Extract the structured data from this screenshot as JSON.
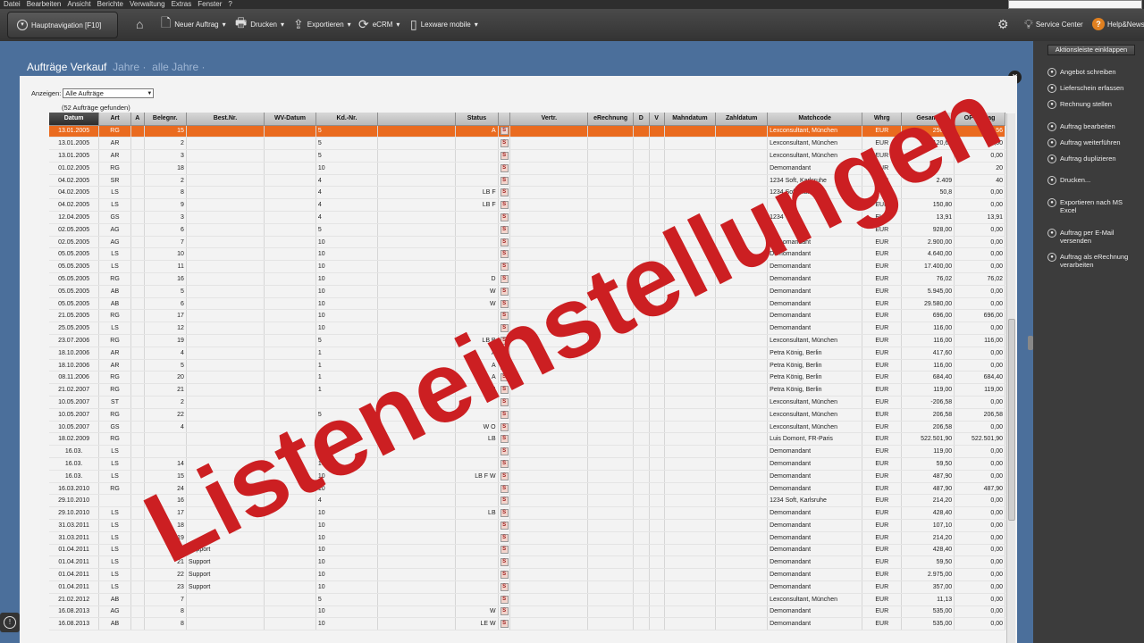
{
  "menu": [
    "Datei",
    "Bearbeiten",
    "Ansicht",
    "Berichte",
    "Verwaltung",
    "Extras",
    "Fenster",
    "?"
  ],
  "toolbar": {
    "hauptnavigation": "Hauptnavigation [F10]",
    "neuer_auftrag": "Neuer Auftrag",
    "drucken": "Drucken",
    "exportieren": "Exportieren",
    "ecrm": "eCRM",
    "lexware_mobile": "Lexware mobile",
    "service_center": "Service Center",
    "help_news": "Help&News"
  },
  "page": {
    "title": "Aufträge Verkauf",
    "crumb_jahre": "Jahre",
    "crumb_alle": "alle Jahre",
    "filter_label": "Anzeigen:",
    "filter_value": "Alle Aufträge",
    "found": "(52 Aufträge gefunden)"
  },
  "columns": [
    "Datum",
    "Art",
    "A",
    "Belegnr.",
    "Best.Nr.",
    "WV-Datum",
    "Kd.-Nr.",
    "",
    "Status",
    "",
    "Vertr.",
    "eRechnung",
    "D",
    "V",
    "Mahndatum",
    "Zahldatum",
    "Matchcode",
    "Whrg",
    "Gesamt",
    "OP-Betrag"
  ],
  "rows": [
    {
      "datum": "13.01.2005",
      "art": "RG",
      "belegnr": "15",
      "best": "",
      "kd": "5",
      "status": "A",
      "match": "Lexconsultant, München",
      "whrg": "EUR",
      "gesamt": "250,56",
      "op": "250,56"
    },
    {
      "datum": "13.01.2005",
      "art": "AR",
      "belegnr": "2",
      "best": "",
      "kd": "5",
      "status": "",
      "match": "Lexconsultant, München",
      "whrg": "EUR",
      "gesamt": "120,64",
      "op": "0,00"
    },
    {
      "datum": "13.01.2005",
      "art": "AR",
      "belegnr": "3",
      "best": "",
      "kd": "5",
      "status": "",
      "match": "Lexconsultant, München",
      "whrg": "EUR",
      "gesamt": "",
      "op": "0,00"
    },
    {
      "datum": "01.02.2005",
      "art": "RG",
      "belegnr": "18",
      "best": "",
      "kd": "10",
      "status": "",
      "match": "Demomandant",
      "whrg": "EUR",
      "gesamt": "",
      "op": "20"
    },
    {
      "datum": "04.02.2005",
      "art": "SR",
      "belegnr": "2",
      "best": "",
      "kd": "4",
      "status": "",
      "match": "1234 Soft, Karlsruhe",
      "whrg": "EUR",
      "gesamt": "2.409",
      "op": "40"
    },
    {
      "datum": "04.02.2005",
      "art": "LS",
      "belegnr": "8",
      "best": "",
      "kd": "4",
      "status": "LB F",
      "match": "1234 Soft, Karlsruhe",
      "whrg": "EUR",
      "gesamt": "50,8",
      "op": "0,00"
    },
    {
      "datum": "04.02.2005",
      "art": "LS",
      "belegnr": "9",
      "best": "",
      "kd": "4",
      "status": "LB F",
      "match": "",
      "whrg": "EUR",
      "gesamt": "150,80",
      "op": "0,00"
    },
    {
      "datum": "12.04.2005",
      "art": "GS",
      "belegnr": "3",
      "best": "",
      "kd": "4",
      "status": "",
      "match": "1234",
      "whrg": "EUR",
      "gesamt": "13,91",
      "op": "13,91"
    },
    {
      "datum": "02.05.2005",
      "art": "AG",
      "belegnr": "6",
      "best": "",
      "kd": "5",
      "status": "",
      "match": "",
      "whrg": "EUR",
      "gesamt": "928,00",
      "op": "0,00"
    },
    {
      "datum": "02.05.2005",
      "art": "AG",
      "belegnr": "7",
      "best": "",
      "kd": "10",
      "status": "",
      "match": "Demomandant",
      "whrg": "EUR",
      "gesamt": "2.900,00",
      "op": "0,00"
    },
    {
      "datum": "05.05.2005",
      "art": "LS",
      "belegnr": "10",
      "best": "",
      "kd": "10",
      "status": "",
      "match": "Demomandant",
      "whrg": "EUR",
      "gesamt": "4.640,00",
      "op": "0,00"
    },
    {
      "datum": "05.05.2005",
      "art": "LS",
      "belegnr": "11",
      "best": "",
      "kd": "10",
      "status": "",
      "match": "Demomandant",
      "whrg": "EUR",
      "gesamt": "17.400,00",
      "op": "0,00"
    },
    {
      "datum": "05.05.2005",
      "art": "RG",
      "belegnr": "16",
      "best": "",
      "kd": "10",
      "status": "D",
      "match": "Demomandant",
      "whrg": "EUR",
      "gesamt": "76,02",
      "op": "76,02"
    },
    {
      "datum": "05.05.2005",
      "art": "AB",
      "belegnr": "5",
      "best": "",
      "kd": "10",
      "status": "W",
      "match": "Demomandant",
      "whrg": "EUR",
      "gesamt": "5.945,00",
      "op": "0,00"
    },
    {
      "datum": "05.05.2005",
      "art": "AB",
      "belegnr": "6",
      "best": "",
      "kd": "10",
      "status": "W",
      "match": "Demomandant",
      "whrg": "EUR",
      "gesamt": "29.580,00",
      "op": "0,00"
    },
    {
      "datum": "21.05.2005",
      "art": "RG",
      "belegnr": "17",
      "best": "",
      "kd": "10",
      "status": "",
      "match": "Demomandant",
      "whrg": "EUR",
      "gesamt": "696,00",
      "op": "696,00"
    },
    {
      "datum": "25.05.2005",
      "art": "LS",
      "belegnr": "12",
      "best": "",
      "kd": "10",
      "status": "",
      "match": "Demomandant",
      "whrg": "EUR",
      "gesamt": "116,00",
      "op": "0,00"
    },
    {
      "datum": "23.07.2006",
      "art": "RG",
      "belegnr": "19",
      "best": "",
      "kd": "5",
      "status": "LB B",
      "match": "Lexconsultant, München",
      "whrg": "EUR",
      "gesamt": "116,00",
      "op": "116,00"
    },
    {
      "datum": "18.10.2006",
      "art": "AR",
      "belegnr": "4",
      "best": "",
      "kd": "1",
      "status": "A",
      "match": "Petra König, Berlin",
      "whrg": "EUR",
      "gesamt": "417,60",
      "op": "0,00"
    },
    {
      "datum": "18.10.2006",
      "art": "AR",
      "belegnr": "5",
      "best": "",
      "kd": "1",
      "status": "A",
      "match": "Petra König, Berlin",
      "whrg": "EUR",
      "gesamt": "116,00",
      "op": "0,00"
    },
    {
      "datum": "08.11.2006",
      "art": "RG",
      "belegnr": "20",
      "best": "",
      "kd": "1",
      "status": "A",
      "match": "Petra König, Berlin",
      "whrg": "EUR",
      "gesamt": "684,40",
      "op": "684,40"
    },
    {
      "datum": "21.02.2007",
      "art": "RG",
      "belegnr": "21",
      "best": "",
      "kd": "1",
      "status": "B",
      "match": "Petra König, Berlin",
      "whrg": "EUR",
      "gesamt": "119,00",
      "op": "119,00"
    },
    {
      "datum": "10.05.2007",
      "art": "ST",
      "belegnr": "2",
      "best": "",
      "kd": "",
      "status": "",
      "match": "Lexconsultant, München",
      "whrg": "EUR",
      "gesamt": "-206,58",
      "op": "0,00"
    },
    {
      "datum": "10.05.2007",
      "art": "RG",
      "belegnr": "22",
      "best": "",
      "kd": "5",
      "status": "",
      "match": "Lexconsultant, München",
      "whrg": "EUR",
      "gesamt": "206,58",
      "op": "206,58"
    },
    {
      "datum": "10.05.2007",
      "art": "GS",
      "belegnr": "4",
      "best": "",
      "kd": "",
      "status": "W O",
      "match": "Lexconsultant, München",
      "whrg": "EUR",
      "gesamt": "206,58",
      "op": "0,00"
    },
    {
      "datum": "18.02.2009",
      "art": "RG",
      "belegnr": "",
      "best": "",
      "kd": "3",
      "status": "LB",
      "match": "Luis Domont, FR-Paris",
      "whrg": "EUR",
      "gesamt": "522.501,90",
      "op": "522.501,90"
    },
    {
      "datum": "16.03.",
      "art": "LS",
      "belegnr": "",
      "best": "",
      "kd": "10",
      "status": "",
      "match": "Demomandant",
      "whrg": "EUR",
      "gesamt": "119,00",
      "op": "0,00"
    },
    {
      "datum": "16.03.",
      "art": "LS",
      "belegnr": "14",
      "best": "",
      "kd": "10",
      "status": "",
      "match": "Demomandant",
      "whrg": "EUR",
      "gesamt": "59,50",
      "op": "0,00"
    },
    {
      "datum": "16.03.",
      "art": "LS",
      "belegnr": "15",
      "best": "",
      "kd": "10",
      "status": "LB F W",
      "match": "Demomandant",
      "whrg": "EUR",
      "gesamt": "487,90",
      "op": "0,00"
    },
    {
      "datum": "16.03.2010",
      "art": "RG",
      "belegnr": "24",
      "best": "",
      "kd": "10",
      "status": "",
      "match": "Demomandant",
      "whrg": "EUR",
      "gesamt": "487,90",
      "op": "487,90"
    },
    {
      "datum": "29.10.2010",
      "art": "",
      "belegnr": "16",
      "best": "",
      "kd": "4",
      "status": "",
      "match": "1234 Soft, Karlsruhe",
      "whrg": "EUR",
      "gesamt": "214,20",
      "op": "0,00"
    },
    {
      "datum": "29.10.2010",
      "art": "LS",
      "belegnr": "17",
      "best": "",
      "kd": "10",
      "status": "LB",
      "match": "Demomandant",
      "whrg": "EUR",
      "gesamt": "428,40",
      "op": "0,00"
    },
    {
      "datum": "31.03.2011",
      "art": "LS",
      "belegnr": "18",
      "best": "",
      "kd": "10",
      "status": "",
      "match": "Demomandant",
      "whrg": "EUR",
      "gesamt": "107,10",
      "op": "0,00"
    },
    {
      "datum": "31.03.2011",
      "art": "LS",
      "belegnr": "19",
      "best": "",
      "kd": "10",
      "status": "",
      "match": "Demomandant",
      "whrg": "EUR",
      "gesamt": "214,20",
      "op": "0,00"
    },
    {
      "datum": "01.04.2011",
      "art": "LS",
      "belegnr": "20",
      "best": "Support",
      "kd": "10",
      "status": "",
      "match": "Demomandant",
      "whrg": "EUR",
      "gesamt": "428,40",
      "op": "0,00"
    },
    {
      "datum": "01.04.2011",
      "art": "LS",
      "belegnr": "21",
      "best": "Support",
      "kd": "10",
      "status": "",
      "match": "Demomandant",
      "whrg": "EUR",
      "gesamt": "59,50",
      "op": "0,00"
    },
    {
      "datum": "01.04.2011",
      "art": "LS",
      "belegnr": "22",
      "best": "Support",
      "kd": "10",
      "status": "",
      "match": "Demomandant",
      "whrg": "EUR",
      "gesamt": "2.975,00",
      "op": "0,00"
    },
    {
      "datum": "01.04.2011",
      "art": "LS",
      "belegnr": "23",
      "best": "Support",
      "kd": "10",
      "status": "",
      "match": "Demomandant",
      "whrg": "EUR",
      "gesamt": "357,00",
      "op": "0,00"
    },
    {
      "datum": "21.02.2012",
      "art": "AB",
      "belegnr": "7",
      "best": "",
      "kd": "5",
      "status": "",
      "match": "Lexconsultant, München",
      "whrg": "EUR",
      "gesamt": "11,13",
      "op": "0,00"
    },
    {
      "datum": "16.08.2013",
      "art": "AG",
      "belegnr": "8",
      "best": "",
      "kd": "10",
      "status": "W",
      "match": "Demomandant",
      "whrg": "EUR",
      "gesamt": "535,00",
      "op": "0,00"
    },
    {
      "datum": "16.08.2013",
      "art": "AB",
      "belegnr": "8",
      "best": "",
      "kd": "10",
      "status": "LE W",
      "match": "Demomandant",
      "whrg": "EUR",
      "gesamt": "535,00",
      "op": "0,00"
    }
  ],
  "sidebar": {
    "collapse": "Aktionsleiste einklappen",
    "items": [
      "Angebot schreiben",
      "Lieferschein erfassen",
      "Rechnung stellen",
      "Auftrag bearbeiten",
      "Auftrag weiterführen",
      "Auftrag duplizieren",
      "Drucken...",
      "Exportieren nach MS Excel",
      "Auftrag per E-Mail versenden",
      "Auftrag als eRechnung verarbeiten"
    ]
  },
  "overlay_text": "Listeneinstellungen",
  "colors": {
    "selected_row": "#ea6b1f",
    "overlay": "#cc1f22",
    "background": "#4b6f9b"
  }
}
